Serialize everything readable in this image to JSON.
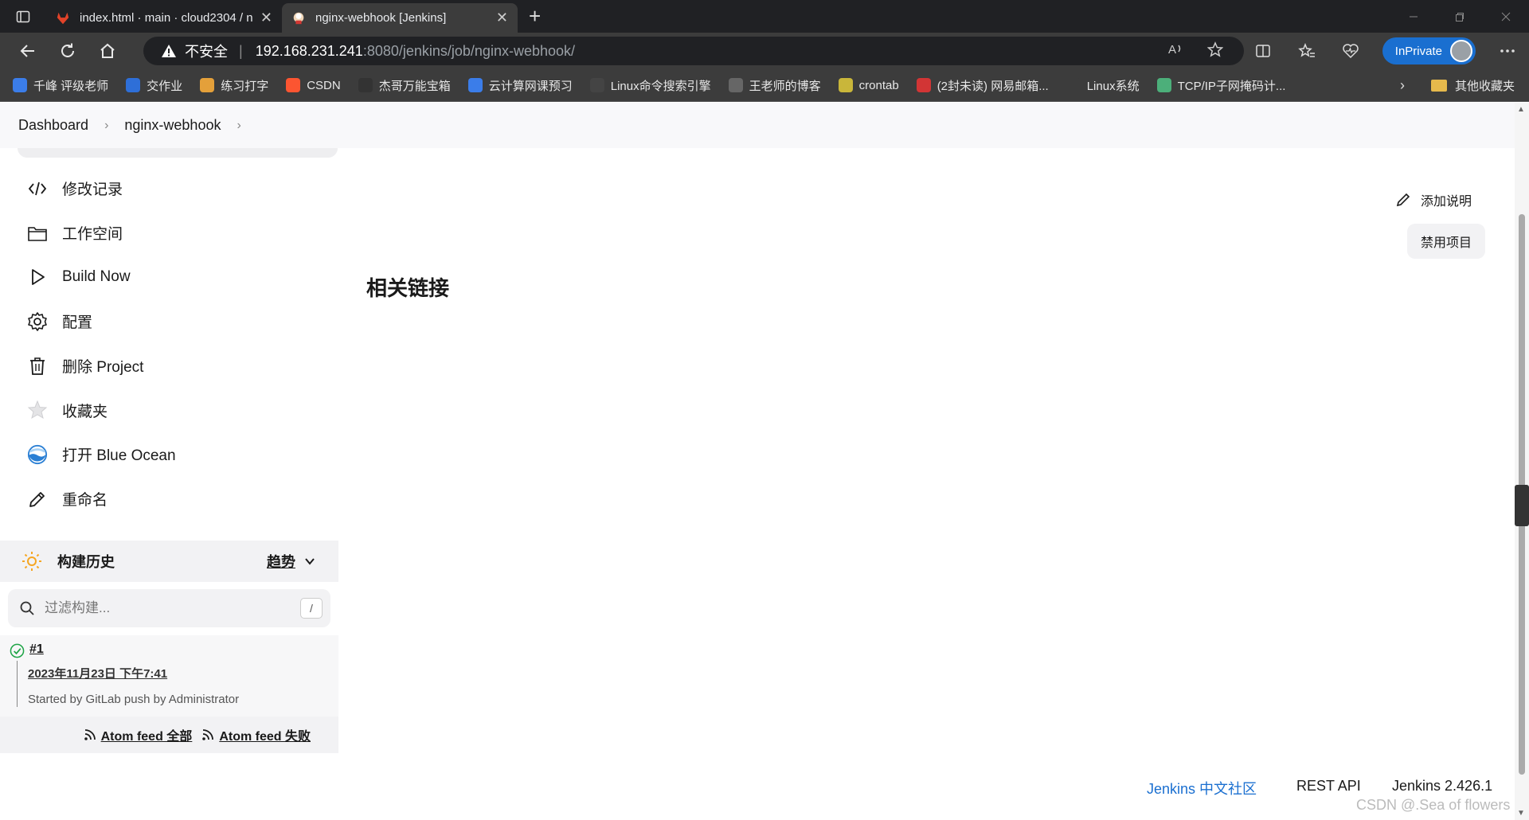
{
  "tabs": [
    {
      "title": "index.html · main · cloud2304 / n",
      "close": "✕"
    },
    {
      "title": "nginx-webhook [Jenkins]",
      "close": "✕"
    }
  ],
  "new_tab": "+",
  "address": {
    "warning_label": "不安全",
    "host": "192.168.231.241",
    "path": ":8080/jenkins/job/nginx-webhook/"
  },
  "inprivate_label": "InPrivate",
  "bookmarks": [
    {
      "label": "千峰 评级老师",
      "color": "#3b7de9"
    },
    {
      "label": "交作业",
      "color": "#2e6fd8"
    },
    {
      "label": "练习打字",
      "color": "#e4a03a"
    },
    {
      "label": "CSDN",
      "color": "#fc5531"
    },
    {
      "label": "杰哥万能宝箱",
      "color": "#333333"
    },
    {
      "label": "云计算网课预习",
      "color": "#3b7de9"
    },
    {
      "label": "Linux命令搜索引擎",
      "color": "#444444"
    },
    {
      "label": "王老师的博客",
      "color": "#666666"
    },
    {
      "label": "crontab",
      "color": "#c9b63a"
    },
    {
      "label": "(2封未读) 网易邮箱...",
      "color": "#d23535"
    },
    {
      "label": "Linux系统",
      "color": "#3c3c3c"
    },
    {
      "label": "TCP/IP子网掩码计...",
      "color": "#4caf7a"
    }
  ],
  "bookmarks_other": "其他收藏夹",
  "breadcrumb": {
    "items": [
      "Dashboard",
      "nginx-webhook"
    ],
    "chevron": "›"
  },
  "side_menu": [
    {
      "label": "修改记录",
      "icon": "code-icon"
    },
    {
      "label": "工作空间",
      "icon": "folder-icon"
    },
    {
      "label": "Build Now",
      "icon": "play-icon"
    },
    {
      "label": "配置",
      "icon": "gear-icon"
    },
    {
      "label": "删除 Project",
      "icon": "trash-icon"
    },
    {
      "label": "收藏夹",
      "icon": "star-icon"
    },
    {
      "label": "打开 Blue Ocean",
      "icon": "blue-ocean-icon"
    },
    {
      "label": "重命名",
      "icon": "pencil-icon"
    }
  ],
  "build_history": {
    "title": "构建历史",
    "trend": "趋势",
    "filter_placeholder": "过滤构建...",
    "filter_shortcut": "/",
    "builds": [
      {
        "number": "#1",
        "date": "2023年11月23日 下午7:41",
        "cause": "Started by GitLab push by Administrator"
      }
    ],
    "feed_all": "Atom feed 全部",
    "feed_failed": "Atom feed 失败"
  },
  "main": {
    "add_description": "添加说明",
    "disable_project": "禁用项目",
    "related_links": "相关链接"
  },
  "footer": {
    "community": "Jenkins 中文社区",
    "rest_api": "REST API",
    "version": "Jenkins 2.426.1"
  },
  "watermark": "CSDN @.Sea of flowers"
}
